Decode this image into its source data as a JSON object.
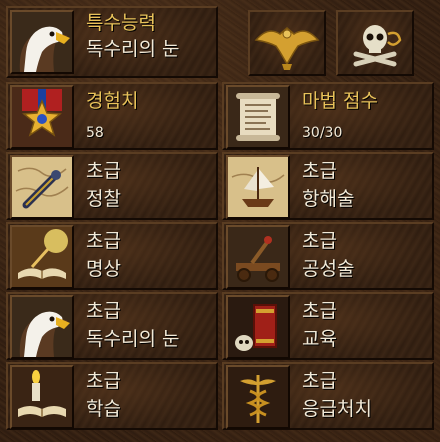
{
  "specialty": {
    "title": "특수능력",
    "name": "독수리의 눈"
  },
  "experience": {
    "label": "경험치",
    "value": "58"
  },
  "mana": {
    "label": "마법 점수",
    "value": "30/30"
  },
  "skills": [
    {
      "level": "초급",
      "name": "정찰"
    },
    {
      "level": "초급",
      "name": "항해술"
    },
    {
      "level": "초급",
      "name": "명상"
    },
    {
      "level": "초급",
      "name": "공성술"
    },
    {
      "level": "초급",
      "name": "독수리의 눈"
    },
    {
      "level": "초급",
      "name": "교육"
    },
    {
      "level": "초급",
      "name": "학습"
    },
    {
      "level": "초급",
      "name": "응급처치"
    }
  ],
  "colors": {
    "gold": "#e8c25a",
    "text": "#f2ead8",
    "leather": "#3a2414"
  },
  "icons": {
    "specialty": "eagle-icon",
    "artifact1": "golden-eagle-icon",
    "artifact2": "skull-crossbones-icon",
    "experience": "star-medal-icon",
    "mana": "scroll-icon",
    "skills": [
      "telescope-map-icon",
      "ship-map-icon",
      "open-book-icon",
      "catapult-icon",
      "eagle-icon",
      "book-skull-icon",
      "candle-book-icon",
      "caduceus-icon"
    ]
  }
}
